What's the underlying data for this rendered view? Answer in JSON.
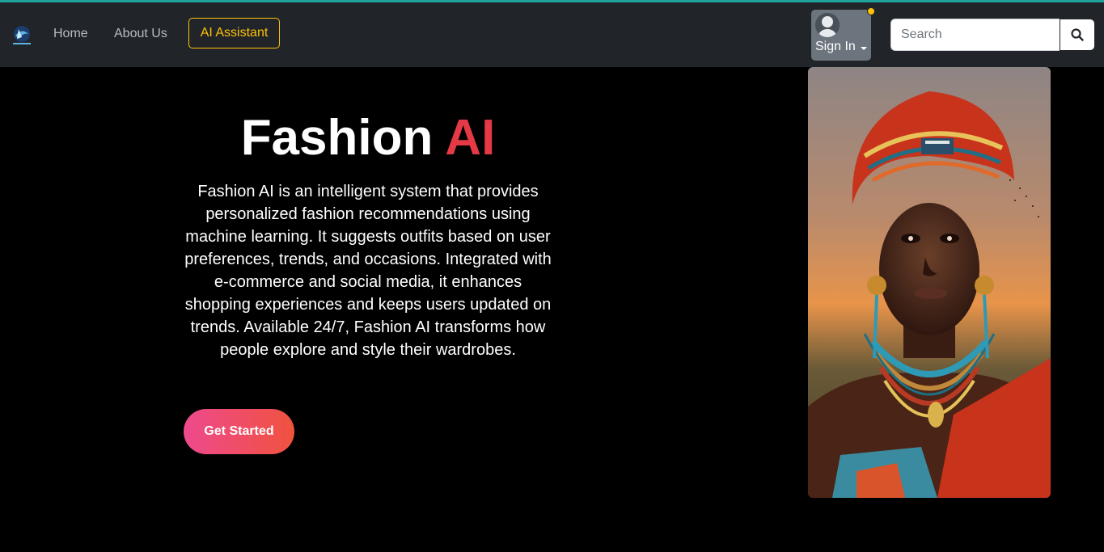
{
  "navbar": {
    "logo_icon": "brand-logo-icon",
    "links": [
      "Home",
      "About Us"
    ],
    "ai_assistant": "AI Assistant",
    "sign_in": "Sign In",
    "search_placeholder": "Search",
    "accent_color": "#ffc107"
  },
  "hero": {
    "title_main": "Fashion ",
    "title_accent": "AI",
    "description": "Fashion AI is an intelligent system that provides personalized fashion recommendations using machine learning. It suggests outfits based on user preferences, trends, and occasions. Integrated with e-commerce and social media, it enhances shopping experiences and keeps users updated on trends. Available 24/7, Fashion AI transforms how people explore and style their wardrobes.",
    "cta_label": "Get Started",
    "title_accent_color": "#e63946"
  },
  "colors": {
    "navbar_bg": "#212529",
    "page_bg": "#000000",
    "cta_gradient_start": "#ee4a8e",
    "cta_gradient_end": "#f0523e"
  }
}
